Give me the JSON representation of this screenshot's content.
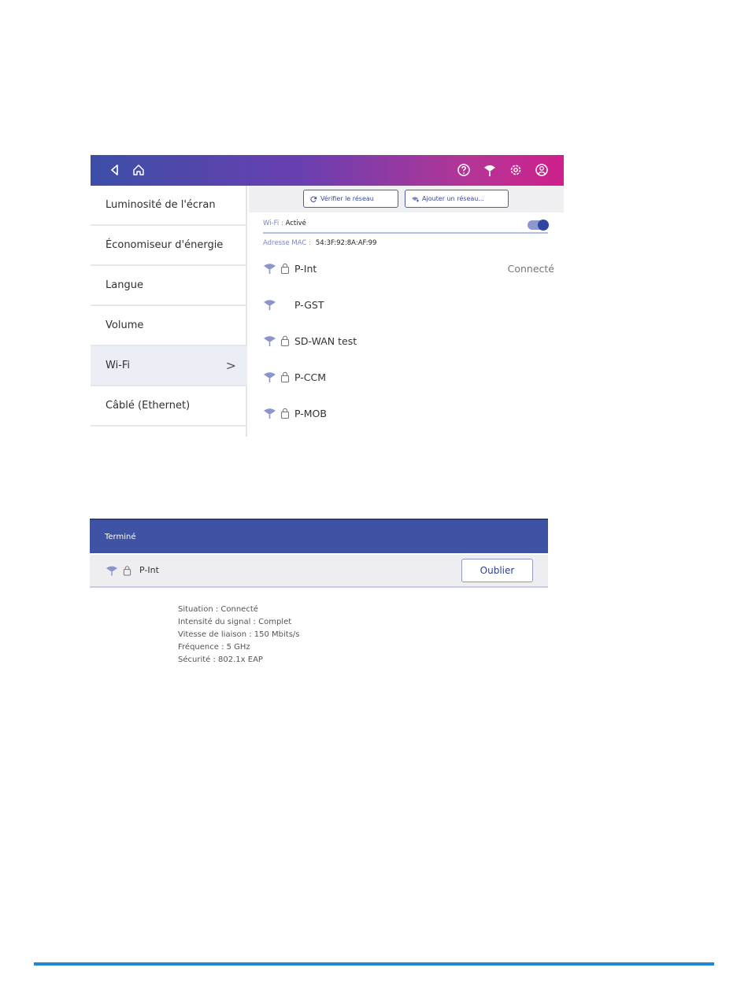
{
  "screen1": {
    "sidebar": {
      "items": [
        {
          "label": "Luminosité de l'écran"
        },
        {
          "label": "Économiseur d'énergie"
        },
        {
          "label": "Langue"
        },
        {
          "label": "Volume"
        },
        {
          "label": "Wi-Fi",
          "chevron": ">"
        },
        {
          "label": "Câblé (Ethernet)"
        }
      ]
    },
    "buttons": {
      "check_network": "Vérifier le réseau",
      "add_network": "Ajouter un réseau..."
    },
    "wifi": {
      "label": "Wi-Fi :",
      "value": "Activé"
    },
    "mac": {
      "label": "Adresse MAC :",
      "value": "54:3F:92:8A:AF:99"
    },
    "networks": [
      {
        "name": "P-Int",
        "status": "Connecté"
      },
      {
        "name": "P-GST"
      },
      {
        "name": "SD-WAN test"
      },
      {
        "name": "P-CCM"
      },
      {
        "name": "P-MOB"
      }
    ]
  },
  "screen2": {
    "header": "Terminé",
    "network_name": "P-Int",
    "forget_label": "Oublier",
    "details": [
      "Situation : Connecté",
      "Intensité du signal : Complet",
      "Vitesse de liaison : 150 Mbits/s",
      "Fréquence : 5 GHz",
      "Sécurité : 802.1x EAP"
    ]
  },
  "colors": {
    "accent": "#3f53a4",
    "gradient_start": "#3c4fa8",
    "gradient_end": "#cf1f8c",
    "rule": "#1a8ad6"
  }
}
